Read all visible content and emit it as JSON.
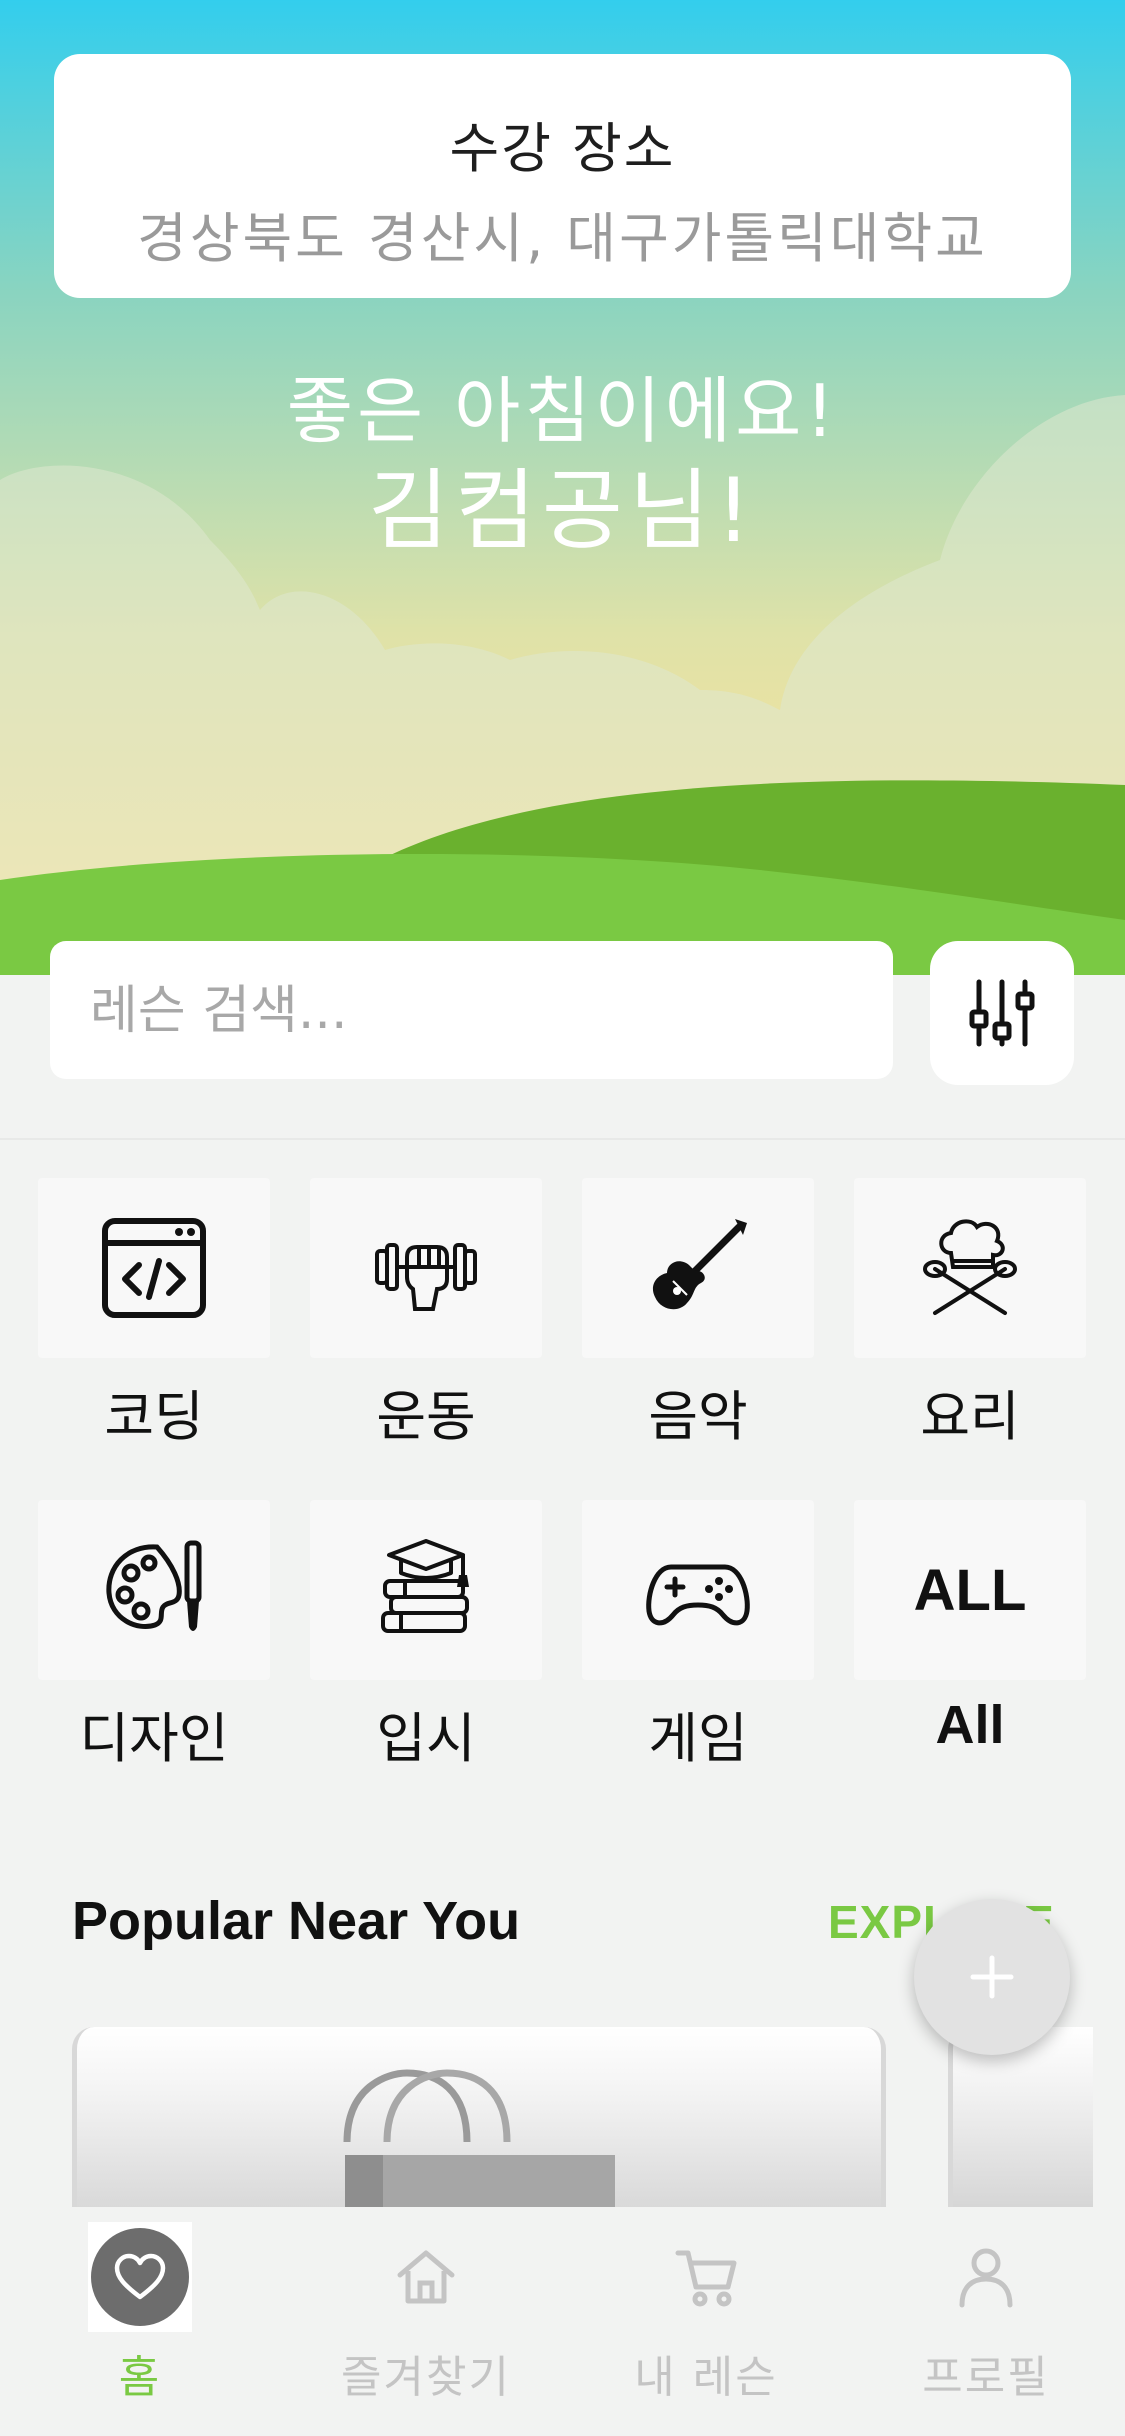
{
  "location": {
    "title": "수강 장소",
    "address": "경상북도 경산시, 대구가톨릭대학교"
  },
  "greeting": {
    "line1": "좋은 아침이에요!",
    "line2": "김컴공님!"
  },
  "search": {
    "placeholder": "레슨 검색..."
  },
  "categories": [
    {
      "label": "코딩",
      "icon": "code-window-icon"
    },
    {
      "label": "운동",
      "icon": "dumbbell-fist-icon"
    },
    {
      "label": "음악",
      "icon": "electric-guitar-icon"
    },
    {
      "label": "요리",
      "icon": "chef-hat-utensils-icon"
    },
    {
      "label": "디자인",
      "icon": "palette-brush-icon"
    },
    {
      "label": "입시",
      "icon": "books-graduation-cap-icon"
    },
    {
      "label": "게임",
      "icon": "gamepad-icon"
    },
    {
      "label": "All",
      "tile_text": "ALL"
    }
  ],
  "popular": {
    "title": "Popular Near You",
    "explore": "EXPLORE"
  },
  "tabs": [
    {
      "label": "홈",
      "icon": "heart-icon",
      "active": true
    },
    {
      "label": "즐겨찾기",
      "icon": "house-icon",
      "active": false
    },
    {
      "label": "내 레슨",
      "icon": "cart-icon",
      "active": false
    },
    {
      "label": "프로필",
      "icon": "person-icon",
      "active": false
    }
  ],
  "colors": {
    "accent": "#7ac943",
    "sky_top": "#34cfec",
    "grass": "#7ac943"
  }
}
